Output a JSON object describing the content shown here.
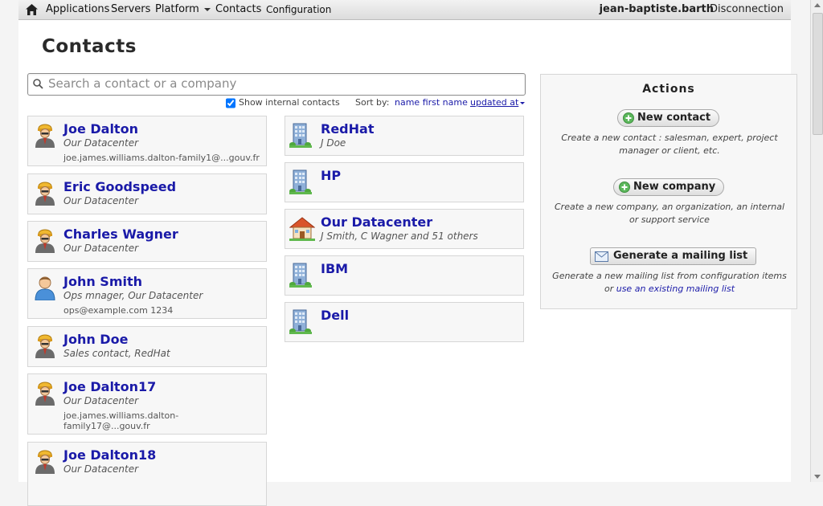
{
  "nav": {
    "items": [
      "Applications",
      "Servers",
      "Platform",
      "Contacts",
      "Configuration"
    ],
    "user": "jean-baptiste.barth",
    "logout": "Disconnection"
  },
  "page": {
    "title": "Contacts"
  },
  "search": {
    "placeholder": "Search a contact or a company",
    "value": ""
  },
  "filters": {
    "show_internal_label": "Show internal contacts",
    "show_internal_checked": true,
    "sort_label": "Sort by:",
    "sort_options": [
      "name",
      "first name",
      "updated at"
    ],
    "sort_option_1": "name first name",
    "sort_selected": "updated at"
  },
  "people": [
    {
      "name": "Joe Dalton",
      "org": "Our Datacenter",
      "extra": "joe.james.williams.dalton-family1@...gouv.fr",
      "avatar": "worker-icon"
    },
    {
      "name": "Eric Goodspeed",
      "org": "Our Datacenter",
      "extra": "",
      "avatar": "worker-icon"
    },
    {
      "name": "Charles Wagner",
      "org": "Our Datacenter",
      "extra": "",
      "avatar": "worker-icon"
    },
    {
      "name": "John Smith",
      "org": "Ops mnager, Our Datacenter",
      "extra": "ops@example.com 1234",
      "avatar": "user-icon"
    },
    {
      "name": "John Doe",
      "org": "Sales contact, RedHat",
      "extra": "",
      "avatar": "worker-icon"
    },
    {
      "name": "Joe Dalton17",
      "org": "Our Datacenter",
      "extra": "joe.james.williams.dalton-family17@...gouv.fr",
      "avatar": "worker-icon"
    },
    {
      "name": "Joe Dalton18",
      "org": "Our Datacenter",
      "extra": "",
      "avatar": "worker-icon"
    }
  ],
  "companies": [
    {
      "name": "RedHat",
      "members": "J Doe",
      "icon": "building-icon"
    },
    {
      "name": "HP",
      "members": "",
      "icon": "building-icon"
    },
    {
      "name": "Our Datacenter",
      "members": "J Smith, C Wagner and 51 others",
      "icon": "house-icon"
    },
    {
      "name": "IBM",
      "members": "",
      "icon": "building-icon"
    },
    {
      "name": "Dell",
      "members": "",
      "icon": "building-icon"
    }
  ],
  "actions": {
    "title": "Actions",
    "new_contact": "New contact",
    "new_contact_desc": "Create a new contact : salesman, expert, project manager or client, etc.",
    "new_company": "New company",
    "new_company_desc": "Create a new company, an organization, an internal or support service",
    "mailing_list": "Generate a mailing list",
    "mailing_list_desc": "Generate a new mailing list from configuration items",
    "mailing_list_or": "or",
    "mailing_list_link": "use an existing mailing list"
  },
  "colors": {
    "link": "#1a1aa8",
    "card_bg": "#f7f7f7",
    "border": "#d6d6d6"
  }
}
